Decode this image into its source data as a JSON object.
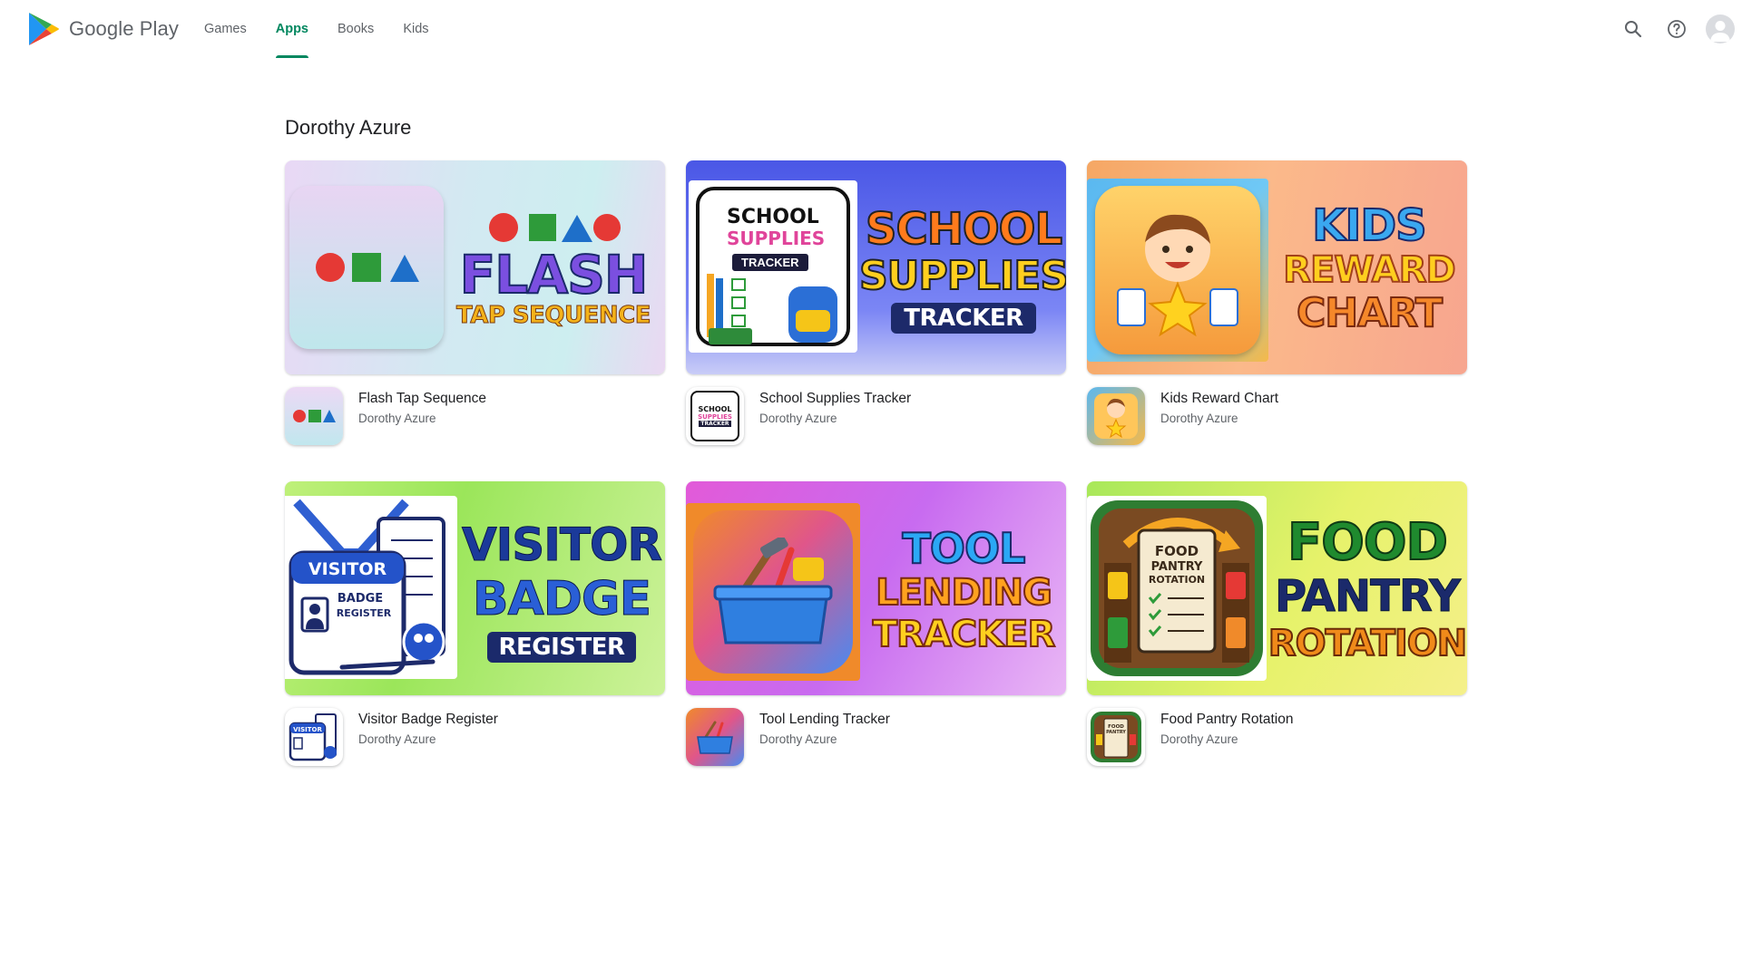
{
  "header": {
    "brand": "Google Play",
    "nav": [
      {
        "label": "Games",
        "active": false
      },
      {
        "label": "Apps",
        "active": true
      },
      {
        "label": "Books",
        "active": false
      },
      {
        "label": "Kids",
        "active": false
      }
    ],
    "icons": [
      "search-icon",
      "help-icon",
      "account-avatar"
    ],
    "accent_color": "#01875f"
  },
  "developer": {
    "name": "Dorothy Azure"
  },
  "apps": [
    {
      "name": "Flash Tap Sequence",
      "developer": "Dorothy Azure",
      "banner_text": [
        "FLASH",
        "TAP SEQUENCE"
      ]
    },
    {
      "name": "School Supplies Tracker",
      "developer": "Dorothy Azure",
      "banner_text": [
        "SCHOOL",
        "SUPPLIES",
        "TRACKER"
      ]
    },
    {
      "name": "Kids Reward Chart",
      "developer": "Dorothy Azure",
      "banner_text": [
        "KIDS",
        "REWARD",
        "CHART"
      ]
    },
    {
      "name": "Visitor Badge Register",
      "developer": "Dorothy Azure",
      "banner_text": [
        "VISITOR",
        "BADGE",
        "REGISTER"
      ]
    },
    {
      "name": "Tool Lending Tracker",
      "developer": "Dorothy Azure",
      "banner_text": [
        "TOOL",
        "LENDING",
        "TRACKER"
      ]
    },
    {
      "name": "Food Pantry Rotation",
      "developer": "Dorothy Azure",
      "banner_text": [
        "FOOD",
        "PANTRY",
        "ROTATION"
      ]
    }
  ]
}
